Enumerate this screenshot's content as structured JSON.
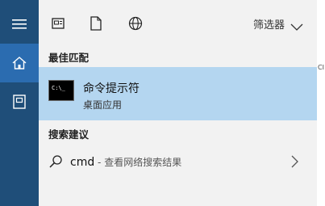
{
  "toolbar": {
    "filter_label": "筛选器"
  },
  "sections": {
    "best_match_title": "最佳匹配",
    "search_suggestions_title": "搜索建议"
  },
  "best_match": {
    "app_name": "命令提示符",
    "app_type": "桌面应用",
    "icon_text": "C:\\_"
  },
  "suggestion": {
    "query": "cmd",
    "hint": " - 查看网络搜索结果"
  },
  "background_text": "CI",
  "colors": {
    "rail": "#1f4e79",
    "rail_active": "#2b6cb0",
    "panel": "#f2f2f2",
    "selected": "#b4d6f0"
  },
  "icons": {
    "rail": [
      "hamburger-menu-icon",
      "home-icon",
      "documents-icon"
    ],
    "toolbar": [
      "apps-icon",
      "document-icon",
      "web-globe-icon",
      "chevron-down-icon"
    ],
    "suggestion": [
      "search-icon",
      "chevron-right-icon"
    ]
  }
}
